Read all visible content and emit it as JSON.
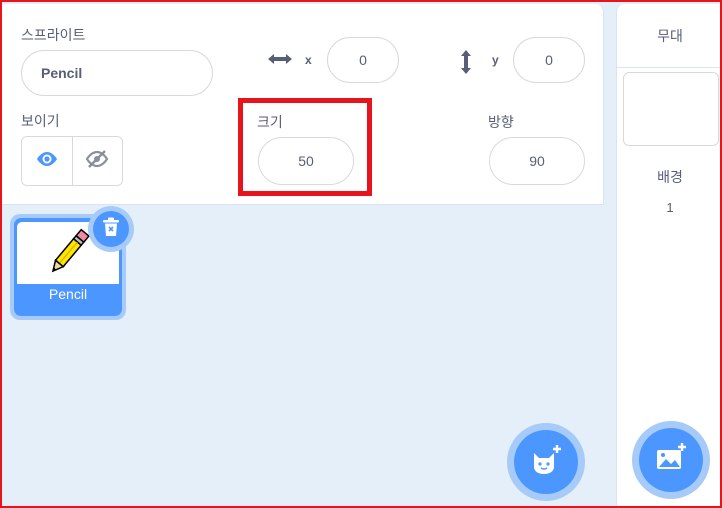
{
  "sprite_info": {
    "sprite_label": "스프라이트",
    "sprite_name": "Pencil",
    "x_label": "x",
    "x_value": "0",
    "y_label": "y",
    "y_value": "0",
    "show_label": "보이기",
    "size_label": "크기",
    "size_value": "50",
    "direction_label": "방향",
    "direction_value": "90"
  },
  "sprite_list": {
    "items": [
      {
        "name": "Pencil",
        "selected": true
      }
    ]
  },
  "stage": {
    "title": "무대",
    "backdrops_label": "배경",
    "backdrops_count": "1"
  },
  "colors": {
    "accent": "#4c97ff",
    "accent_light": "#a7cbf8",
    "highlight": "#e8141c",
    "text": "#575e75"
  }
}
